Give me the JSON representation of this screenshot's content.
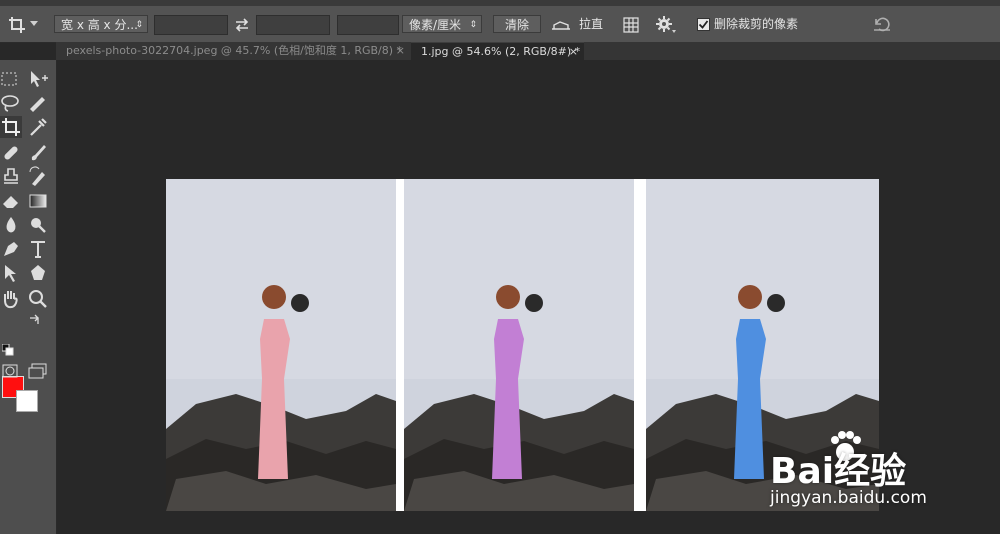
{
  "options_bar": {
    "ratio_preset": "宽 x 高 x 分...",
    "units": "像素/厘米",
    "clear_label": "清除",
    "straighten_label": "拉直",
    "delete_cropped_label": "删除裁剪的像素"
  },
  "tabs": [
    {
      "label": "pexels-photo-3022704.jpeg @ 45.7% (色相/饱和度 1, RGB/8) *",
      "close": "×",
      "active": false
    },
    {
      "label": "1.jpg @ 54.6% (2, RGB/8#) *",
      "close": "×",
      "active": true
    }
  ],
  "colors": {
    "foreground": "#ff0f0f",
    "background": "#ffffff",
    "dress_colors": [
      "#e9a3ac",
      "#c27fd4",
      "#4f8fe0"
    ]
  },
  "icons": [
    "crop-icon",
    "move-icon",
    "marquee-icon",
    "lasso-icon",
    "quick-select-icon",
    "eyedropper-icon",
    "healing-icon",
    "brush-icon",
    "stamp-icon",
    "history-brush-icon",
    "eraser-icon",
    "gradient-icon",
    "blur-icon",
    "dodge-icon",
    "pen-icon",
    "type-icon",
    "path-select-icon",
    "shape-icon",
    "hand-icon",
    "zoom-icon",
    "swap-icon",
    "quickmask-icon",
    "screen-mode-icon",
    "grid-icon",
    "gear-icon",
    "reset-icon"
  ],
  "watermark": {
    "logo": "Bai经验",
    "url": "jingyan.baidu.com"
  }
}
